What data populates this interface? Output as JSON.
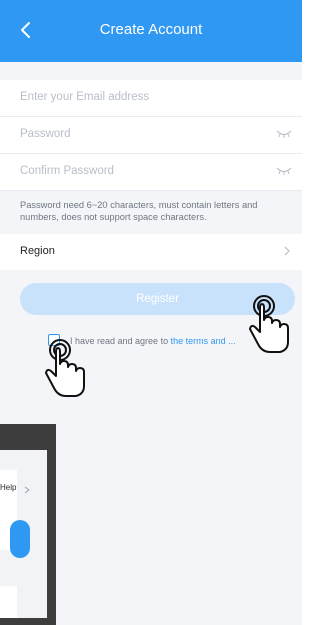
{
  "header": {
    "title": "Create Account",
    "back_icon": "chevron-left-icon"
  },
  "form": {
    "email_placeholder": "Enter your Email address",
    "password_placeholder": "Password",
    "confirm_password_placeholder": "Confirm Password",
    "password_hint": "Password need 6~20 characters, must contain letters and numbers, does not support space characters.",
    "region_label": "Region",
    "register_label": "Register",
    "agree_text": "I have read and agree to",
    "terms_link": "the terms and ..."
  },
  "overlay": {
    "label": "Help"
  },
  "colors": {
    "primary": "#2f98f3",
    "register_disabled": "#c9e2fb"
  },
  "icons": {
    "eye_hidden": "eye-closed-icon",
    "region_chevron": "chevron-right-icon",
    "hand_pointer": "hand-pointer-icon"
  }
}
